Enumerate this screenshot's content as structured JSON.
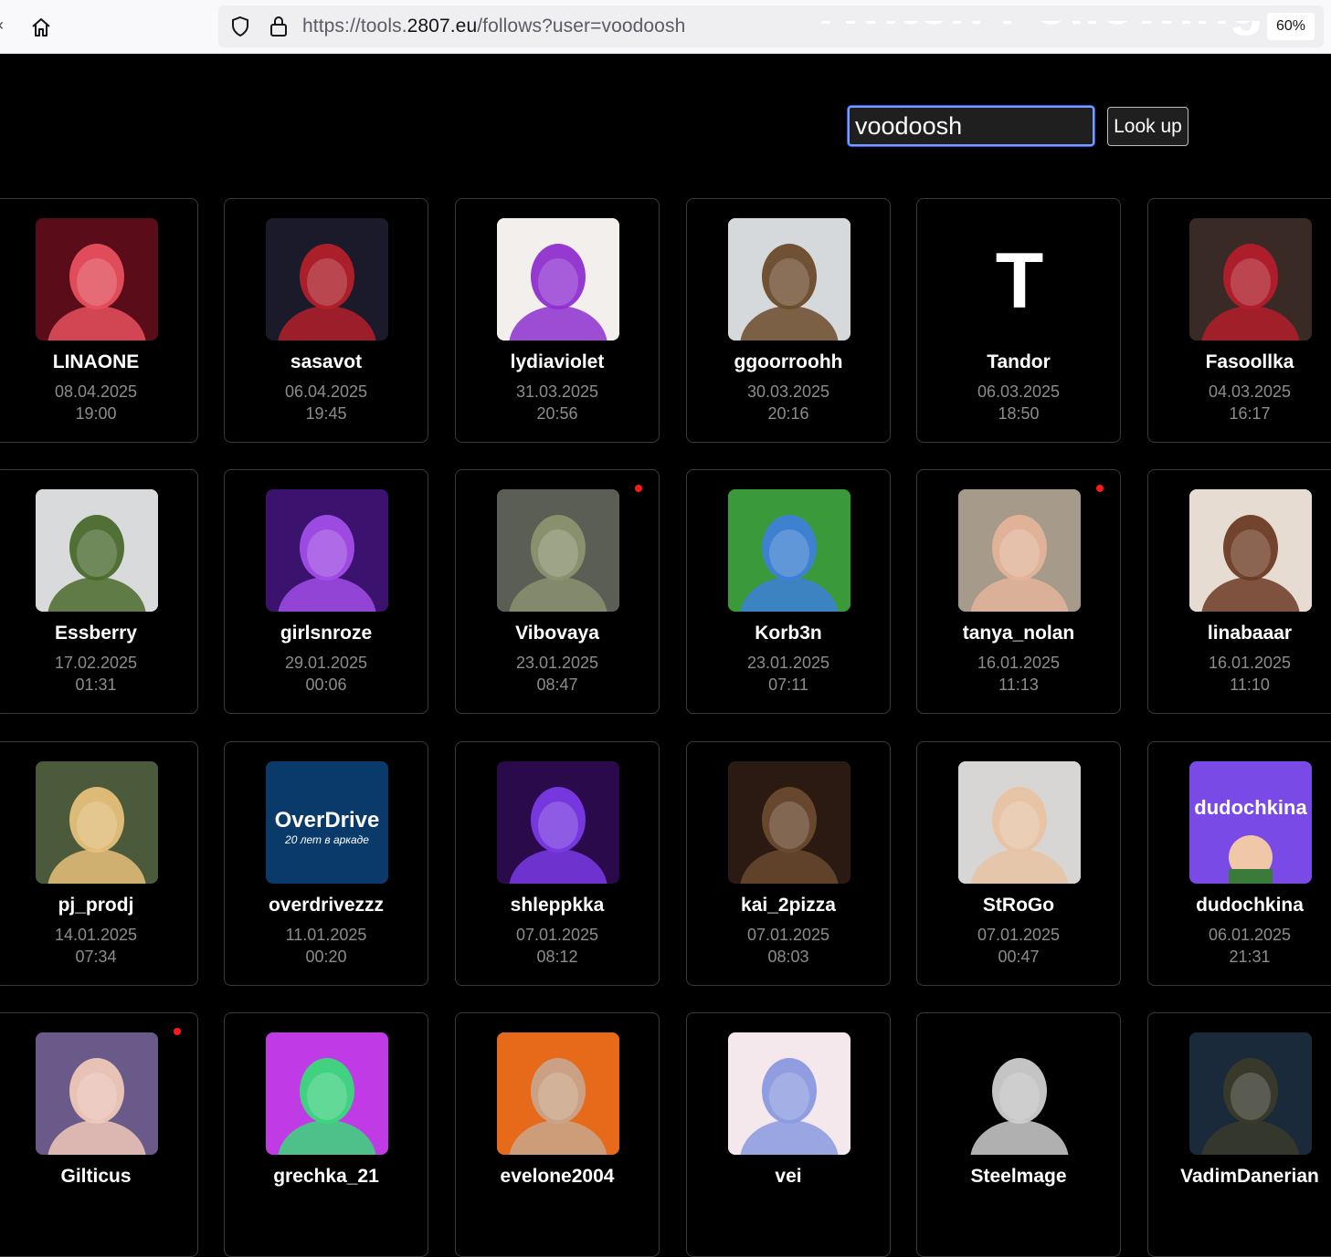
{
  "browser": {
    "url_prefix": "https://tools.",
    "url_domain": "2807.eu",
    "url_path": "/follows?user=voodoosh",
    "zoom": "60%"
  },
  "page": {
    "title": "Twitch Following",
    "search_value": "voodoosh",
    "lookup_label": "Look up"
  },
  "follows": [
    {
      "name": "LINAONE",
      "date": "08.04.2025",
      "time": "19:00",
      "live": false,
      "bg": "#5a0d18",
      "fg": "#e8505e"
    },
    {
      "name": "sasavot",
      "date": "06.04.2025",
      "time": "19:45",
      "live": false,
      "bg": "#1a1a2a",
      "fg": "#b3202a"
    },
    {
      "name": "lydiaviolet",
      "date": "31.03.2025",
      "time": "20:56",
      "live": false,
      "bg": "#f2efec",
      "fg": "#8e2fd0"
    },
    {
      "name": "ggoorroohh",
      "date": "30.03.2025",
      "time": "20:16",
      "live": false,
      "bg": "#d6d9dc",
      "fg": "#6b4a2a"
    },
    {
      "name": "Tandor",
      "date": "06.03.2025",
      "time": "18:50",
      "live": false,
      "bg": "#000000",
      "fg": "#ffffff",
      "letter": "T"
    },
    {
      "name": "Fasoollka",
      "date": "04.03.2025",
      "time": "16:17",
      "live": false,
      "bg": "#3a2a26",
      "fg": "#b31d2a"
    },
    {
      "name": "Essberry",
      "date": "17.02.2025",
      "time": "01:31",
      "live": false,
      "bg": "#d9dadc",
      "fg": "#4a6a2c"
    },
    {
      "name": "girlsnroze",
      "date": "29.01.2025",
      "time": "00:06",
      "live": false,
      "bg": "#3b126e",
      "fg": "#a24ee8"
    },
    {
      "name": "Vibovaya",
      "date": "23.01.2025",
      "time": "08:47",
      "live": true,
      "bg": "#5a5e54",
      "fg": "#8b9270"
    },
    {
      "name": "Korb3n",
      "date": "23.01.2025",
      "time": "07:11",
      "live": false,
      "bg": "#3a9a3a",
      "fg": "#3d7fd9"
    },
    {
      "name": "tanya_nolan",
      "date": "16.01.2025",
      "time": "11:13",
      "live": true,
      "bg": "#a69a8a",
      "fg": "#e3b49a"
    },
    {
      "name": "linabaaar",
      "date": "16.01.2025",
      "time": "11:10",
      "live": false,
      "bg": "#e6dcd2",
      "fg": "#6b3a24"
    },
    {
      "name": "pj_prodj",
      "date": "14.01.2025",
      "time": "07:34",
      "live": false,
      "bg": "#4a5a3a",
      "fg": "#e6c07a"
    },
    {
      "name": "overdrivezzz",
      "date": "11.01.2025",
      "time": "00:20",
      "live": false,
      "bg": "#0a3a6a",
      "fg": "#ffffff",
      "logo1": "OverDrive",
      "logo2": "20 лет в аркаде"
    },
    {
      "name": "shleppkka",
      "date": "07.01.2025",
      "time": "08:12",
      "live": false,
      "bg": "#2a0a4a",
      "fg": "#7a3ae6"
    },
    {
      "name": "kai_2pizza",
      "date": "07.01.2025",
      "time": "08:03",
      "live": false,
      "bg": "#2a1a12",
      "fg": "#6a4a30"
    },
    {
      "name": "StRoGo",
      "date": "07.01.2025",
      "time": "00:47",
      "live": false,
      "bg": "#d8d6d4",
      "fg": "#e8c3a3"
    },
    {
      "name": "dudochkina",
      "date": "06.01.2025",
      "time": "21:31",
      "live": false,
      "bg": "#7a4ae6",
      "fg": "#ffffff",
      "logo1": "dudochkina"
    },
    {
      "name": "Gilticus",
      "date": "",
      "time": "",
      "live": true,
      "bg": "#6a5a8a",
      "fg": "#f0c8b8"
    },
    {
      "name": "grechka_21",
      "date": "",
      "time": "",
      "live": false,
      "bg": "#c03ae6",
      "fg": "#3ad97a"
    },
    {
      "name": "evelone2004",
      "date": "",
      "time": "",
      "live": false,
      "bg": "#e66a1a",
      "fg": "#c8a48a"
    },
    {
      "name": "vei",
      "date": "",
      "time": "",
      "live": false,
      "bg": "#f4e8ec",
      "fg": "#8a9ae0"
    },
    {
      "name": "Steelmage",
      "date": "",
      "time": "",
      "live": false,
      "bg": "#000000",
      "fg": "#cfcfcf"
    },
    {
      "name": "VadimDanerian",
      "date": "",
      "time": "",
      "live": false,
      "bg": "#1a2a3a",
      "fg": "#3a3a2a"
    }
  ]
}
